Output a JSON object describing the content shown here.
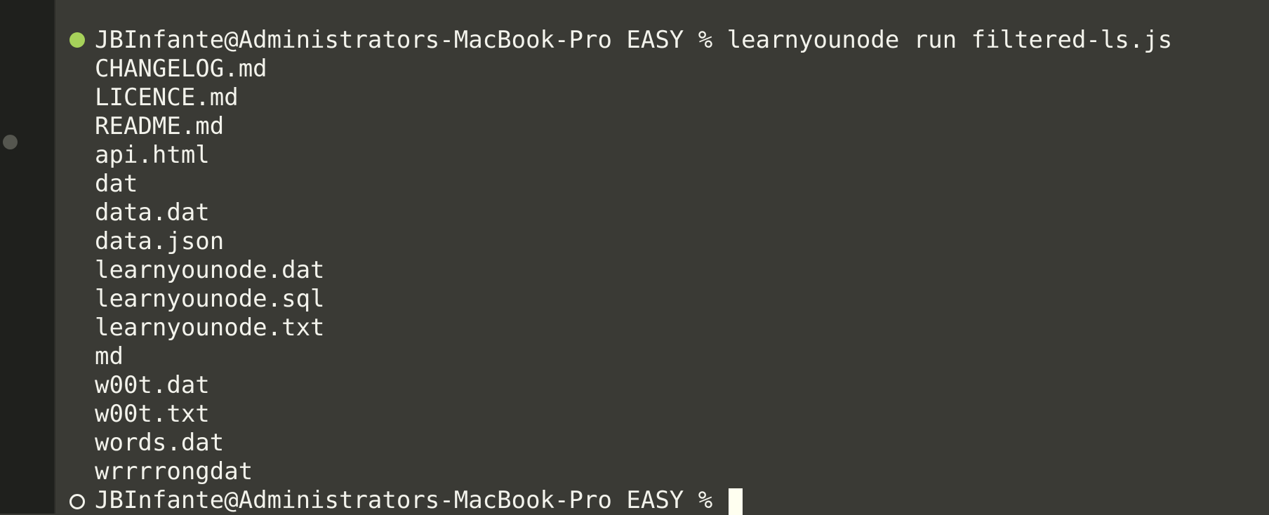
{
  "terminal": {
    "command_prompt": "JBInfante@Administrators-MacBook-Pro EASY % learnyounode run filtered-ls.js",
    "output_lines": [
      "CHANGELOG.md",
      "LICENCE.md",
      "README.md",
      "api.html",
      "dat",
      "data.dat",
      "data.json",
      "learnyounode.dat",
      "learnyounode.sql",
      "learnyounode.txt",
      "md",
      "w00t.dat",
      "w00t.txt",
      "words.dat",
      "wrrrrongdat"
    ],
    "current_prompt": "JBInfante@Administrators-MacBook-Pro EASY % ",
    "colors": {
      "background": "#3a3a35",
      "text": "#f3f3ec",
      "success_marker": "#a6d15a",
      "gutter": "#1f201d"
    }
  }
}
